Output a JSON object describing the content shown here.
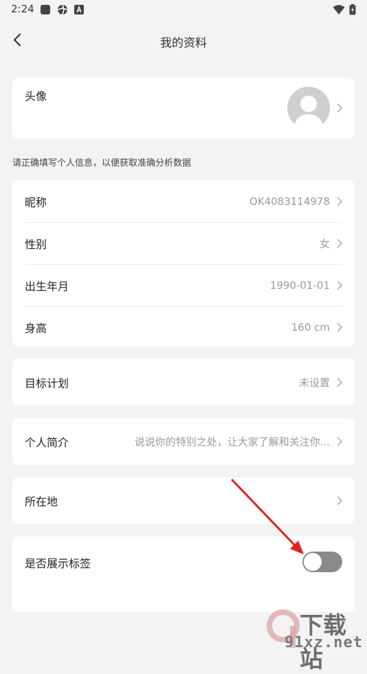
{
  "status_bar": {
    "time": "2:24"
  },
  "header": {
    "title": "我的资料"
  },
  "avatar_section": {
    "label": "头像"
  },
  "hint_text": "请正确填写个人信息，以便获取准确分析数据",
  "info_rows": [
    {
      "label": "昵称",
      "value": "OK4083114978"
    },
    {
      "label": "性别",
      "value": "女"
    },
    {
      "label": "出生年月",
      "value": "1990-01-01"
    },
    {
      "label": "身高",
      "value": "160 cm"
    }
  ],
  "goal_row": {
    "label": "目标计划",
    "value": "未设置"
  },
  "bio_row": {
    "label": "个人简介",
    "value": "说说你的特别之处，让大家了解和关注你..."
  },
  "location_row": {
    "label": "所在地"
  },
  "tags_row": {
    "label": "是否展示标签",
    "toggle_on": false
  },
  "colors": {
    "toggle_off": "#8a8a8a",
    "arrow": "#e02020",
    "background": "#f3f3f3"
  },
  "watermark": {
    "text": "下载站",
    "sub": "91xz.net"
  }
}
